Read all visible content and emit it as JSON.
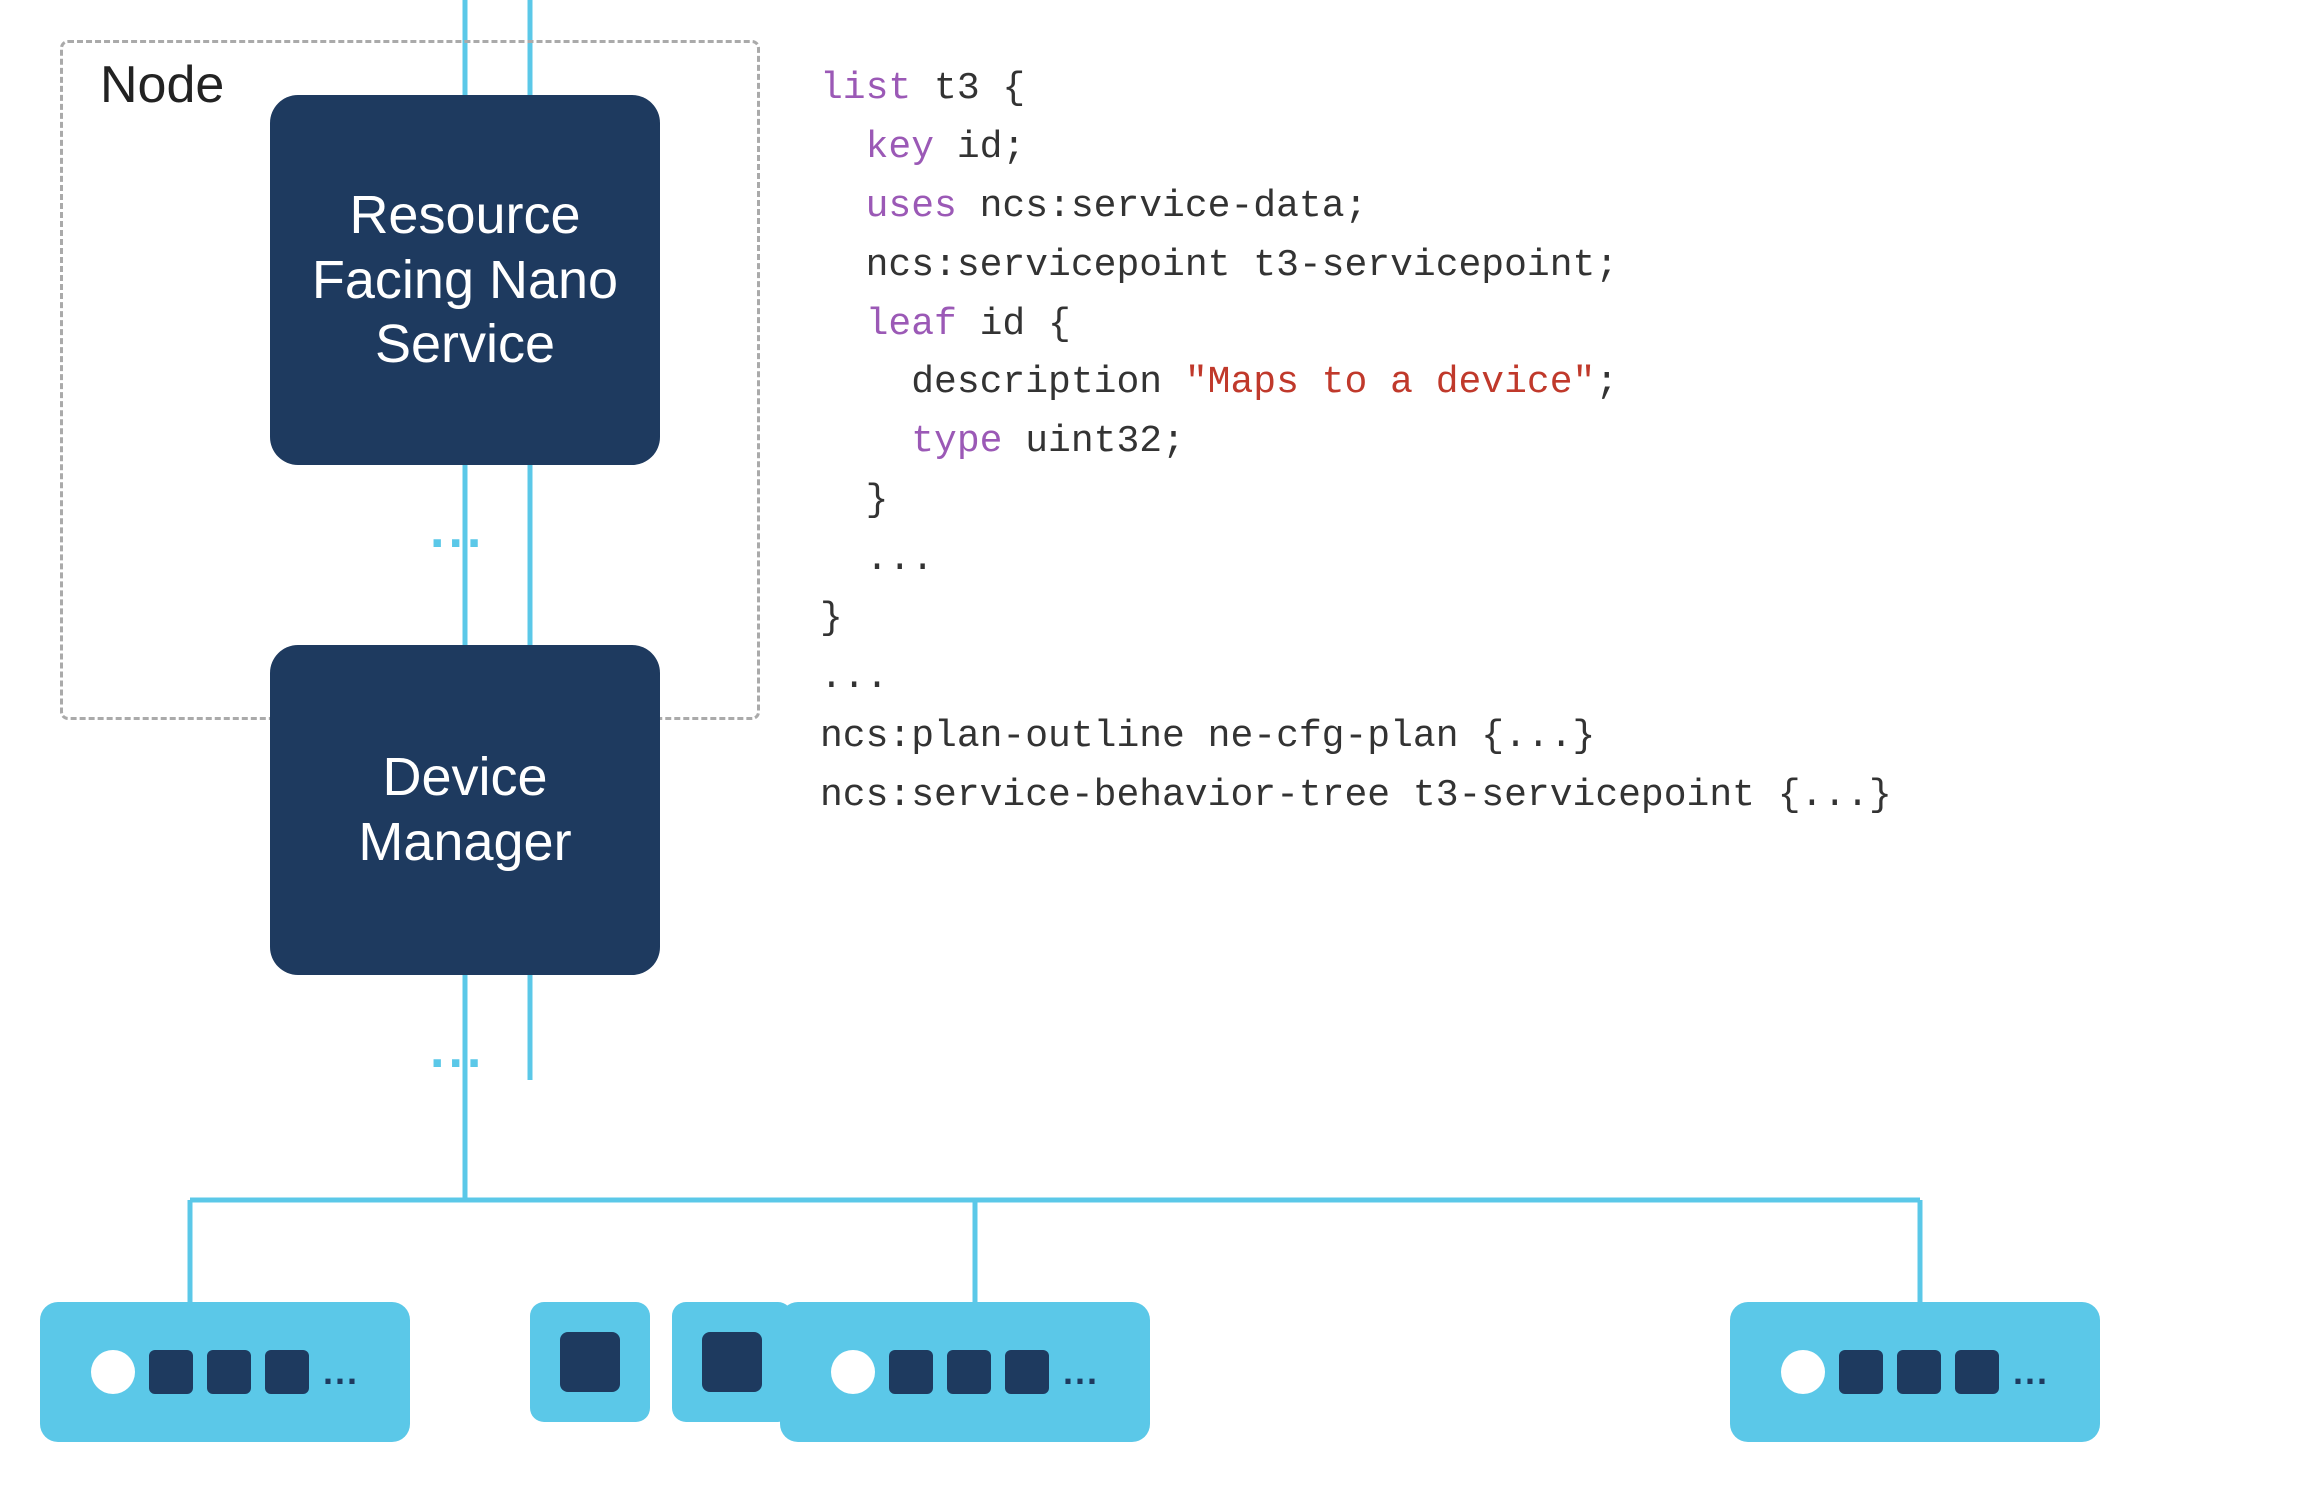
{
  "diagram": {
    "node_label": "Node",
    "rfns_label": "Resource\nFacing Nano\nService",
    "dm_label": "Device\nManager",
    "dots": "...",
    "code": {
      "line1": "list t3 {",
      "line2": "  key id;",
      "line3": "  uses ncs:service-data;",
      "line4": "  ncs:servicepoint t3-servicepoint;",
      "line5": "  leaf id {",
      "line6": "    description \"Maps to a device\";",
      "line7": "    type uint32;",
      "line8": "  }",
      "line9": "  ...",
      "line10": "}",
      "line11": "...",
      "line12": "ncs:plan-outline ne-cfg-plan {...}",
      "line13": "ncs:service-behavior-tree t3-servicepoint {...}"
    }
  }
}
